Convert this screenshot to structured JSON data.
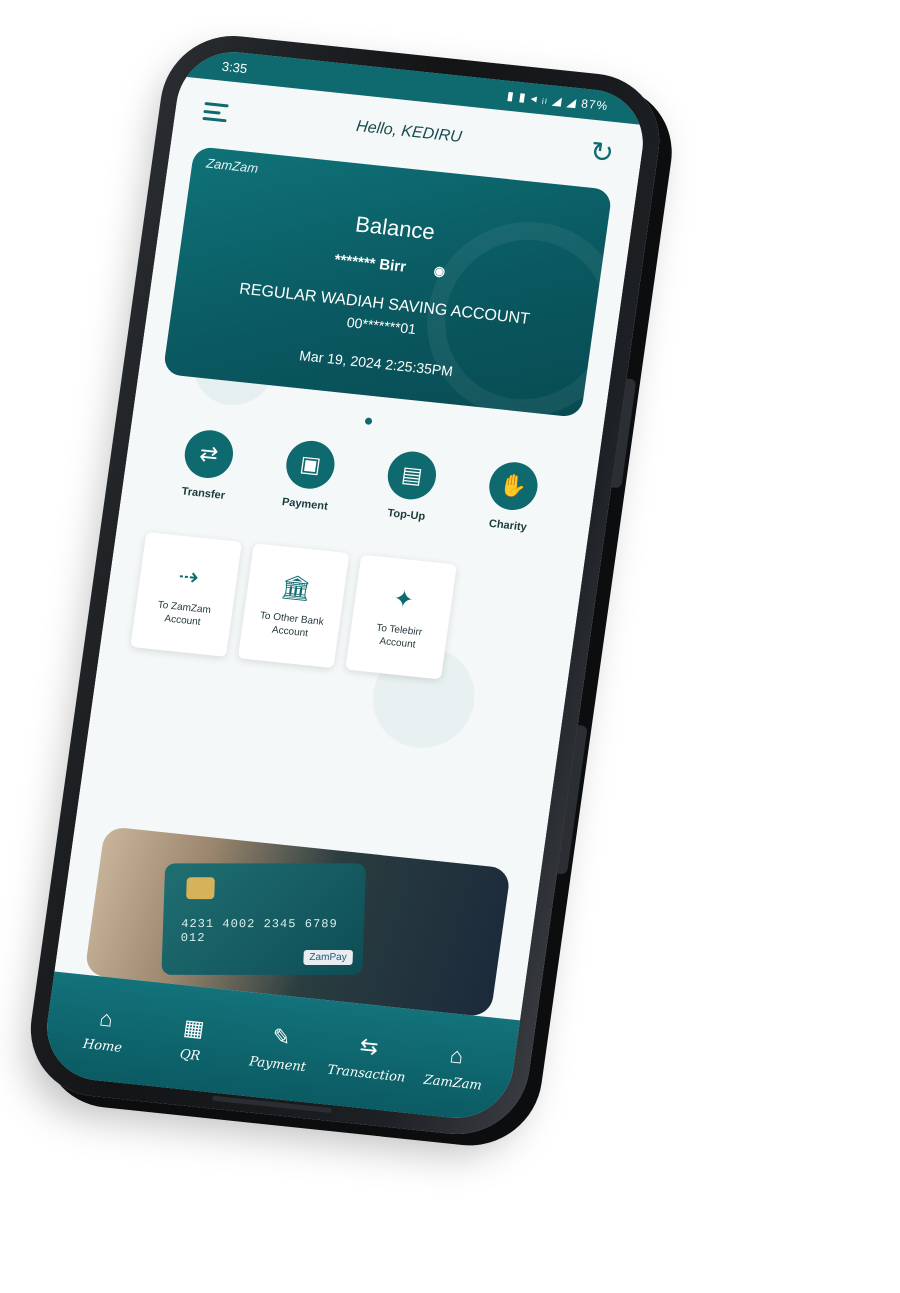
{
  "statusbar": {
    "time": "3:35",
    "indicators": "▮ ▮ ◂ ᵢₗ ◢ ◢ 87%"
  },
  "header": {
    "greeting": "Hello, KEDIRU"
  },
  "balance_card": {
    "logo_text": "ZamZam",
    "title": "Balance",
    "masked_balance": "******* Birr",
    "account_type": "REGULAR WADIAH SAVING ACCOUNT",
    "account_number": "00*******01",
    "timestamp": "Mar 19, 2024 2:25:35PM"
  },
  "quick_actions": [
    {
      "label": "Transfer",
      "icon": "transfer-icon",
      "glyph": "⇄"
    },
    {
      "label": "Payment",
      "icon": "wallet-icon",
      "glyph": "▣"
    },
    {
      "label": "Top-Up",
      "icon": "topup-icon",
      "glyph": "▤"
    },
    {
      "label": "Charity",
      "icon": "charity-icon",
      "glyph": "✋"
    }
  ],
  "transfer_options": [
    {
      "label": "To ZamZam Account",
      "icon": "zamzam-transfer-icon",
      "glyph": "⇢"
    },
    {
      "label": "To Other Bank Account",
      "icon": "bank-icon",
      "glyph": "🏛"
    },
    {
      "label": "To Telebirr Account",
      "icon": "telebirr-icon",
      "glyph": "✦"
    }
  ],
  "banner": {
    "card_number": "4231 4002 2345 6789 012",
    "tag": "ZamPay"
  },
  "bottom_nav": [
    {
      "label": "Home",
      "icon": "home-icon",
      "glyph": "⌂"
    },
    {
      "label": "QR",
      "icon": "qr-icon",
      "glyph": "▦"
    },
    {
      "label": "Payment",
      "icon": "payment-icon",
      "glyph": "✎"
    },
    {
      "label": "Transaction",
      "icon": "transaction-icon",
      "glyph": "⇆"
    },
    {
      "label": "ZamZam",
      "icon": "zamzam-icon",
      "glyph": "⌂"
    }
  ],
  "colors": {
    "brand": "#0f6a6f",
    "brand_dark": "#084b52",
    "background": "#f4f8f8"
  }
}
